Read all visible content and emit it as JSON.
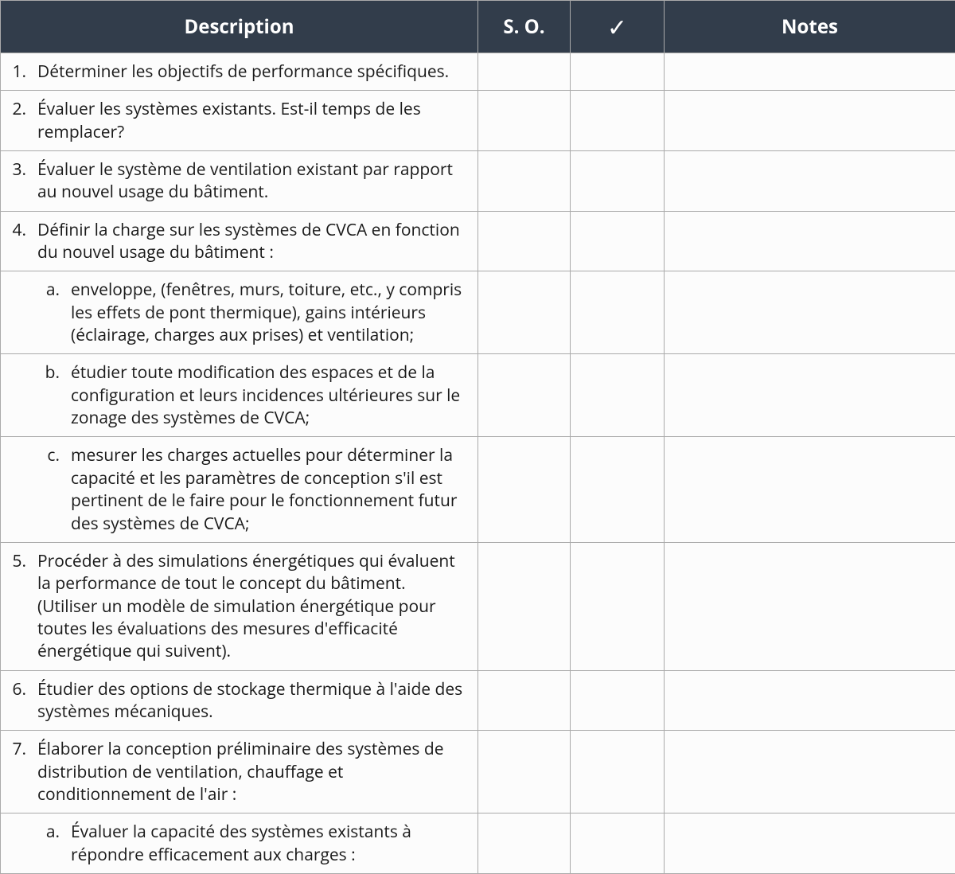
{
  "headers": {
    "description": "Description",
    "so": "S. O.",
    "check": "✓",
    "notes": "Notes"
  },
  "rows": [
    {
      "num": "1.",
      "sub": false,
      "text": "Déterminer les objectifs de performance spécifiques."
    },
    {
      "num": "2.",
      "sub": false,
      "text": "Évaluer les systèmes existants. Est-il temps de les remplacer?"
    },
    {
      "num": "3.",
      "sub": false,
      "text": "Évaluer le système de ventilation existant par rapport au nouvel usage du bâtiment."
    },
    {
      "num": "4.",
      "sub": false,
      "text": "Définir la charge sur les systèmes de CVCA en fonction du nouvel usage du bâtiment :"
    },
    {
      "num": "a.",
      "sub": true,
      "text": "enveloppe, (fenêtres, murs, toiture, etc., y compris les effets de pont thermique), gains intérieurs (éclairage, charges aux prises) et ventilation;"
    },
    {
      "num": "b.",
      "sub": true,
      "text": "étudier toute modification des espaces et de la configuration et leurs incidences ultérieures sur le zonage des systèmes de CVCA;"
    },
    {
      "num": "c.",
      "sub": true,
      "text": "mesurer les charges actuelles pour déter­miner la capacité et les paramètres de con­ception s'il est pertinent de le faire pour le fonctionnement futur des systèmes de CVCA;"
    },
    {
      "num": "5.",
      "sub": false,
      "text": "Procéder à des simulations énergétiques qui évaluent la performance de tout le concept du bâtiment. (Utiliser un modèle de simulation énergétique pour toutes les évaluations des mesures d'efficacité énergétique qui suivent)."
    },
    {
      "num": "6.",
      "sub": false,
      "text": "Étudier des options de stockage thermique à l'aide des systèmes mécaniques."
    },
    {
      "num": "7.",
      "sub": false,
      "text": "Élaborer la conception préliminaire des systèmes de distribution de ventilation, chauffage et conditionnement de l'air :"
    },
    {
      "num": "a.",
      "sub": true,
      "text": "Évaluer la capacité des systèmes existants à répondre efficacement aux charges :"
    }
  ]
}
